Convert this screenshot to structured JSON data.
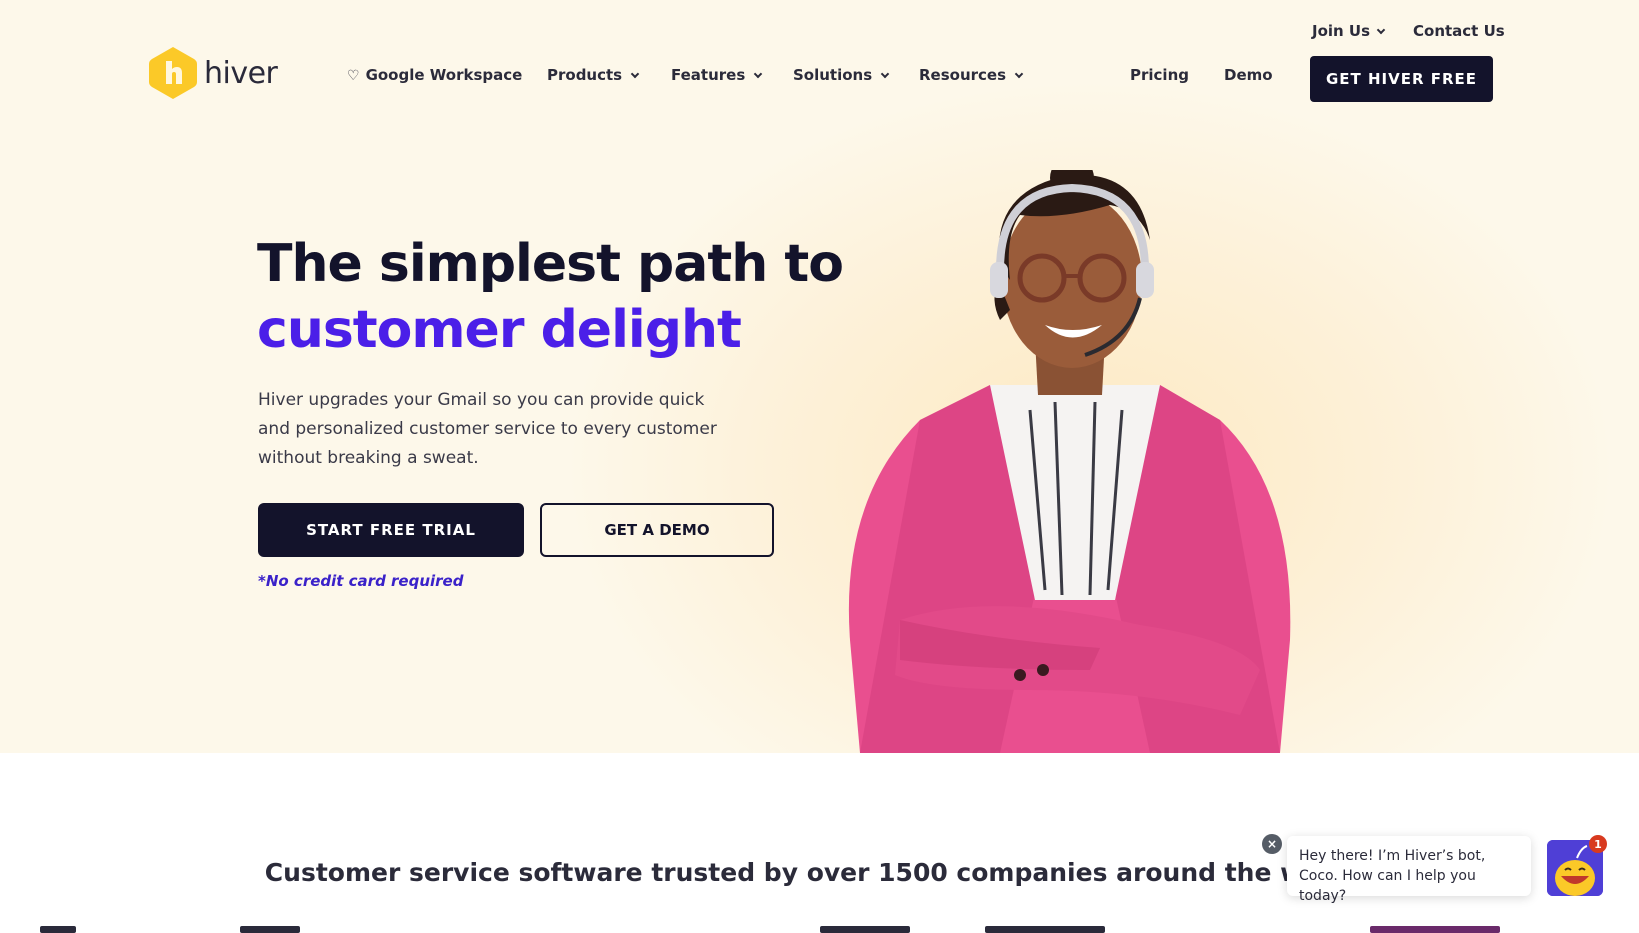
{
  "utility_nav": {
    "join_us": "Join Us",
    "contact_us": "Contact Us"
  },
  "brand": {
    "name": "hiver",
    "accent": "#fbc928"
  },
  "nav": {
    "google_workspace": "Google Workspace",
    "products": "Products",
    "features": "Features",
    "solutions": "Solutions",
    "resources": "Resources",
    "pricing": "Pricing",
    "demo": "Demo",
    "cta": "GET HIVER FREE"
  },
  "hero": {
    "headline_line1": "The simplest path to",
    "headline_line2": "customer delight",
    "subtext": "Hiver upgrades your Gmail so you can provide quick and personalized customer service to every customer without breaking a sweat.",
    "primary_button": "START FREE TRIAL",
    "secondary_button": "GET A DEMO",
    "note": "*No credit card required"
  },
  "trusted": {
    "heading": "Customer service software trusted by over 1500 companies around the world"
  },
  "chat": {
    "message": "Hey there! I’m Hiver’s bot, Coco. How can I help you today?",
    "close": "×",
    "badge": "1"
  },
  "colors": {
    "dark": "#13132b",
    "purple": "#4b1fe8",
    "pink": "#e94f8f"
  }
}
